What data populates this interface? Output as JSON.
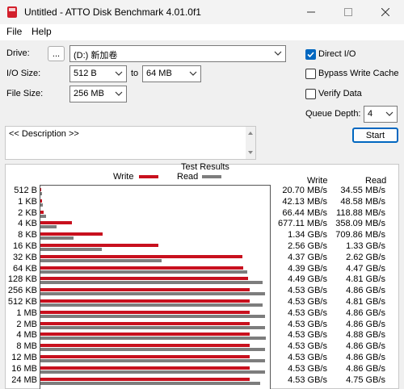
{
  "window": {
    "title": "Untitled - ATTO Disk Benchmark 4.01.0f1"
  },
  "menu": [
    "File",
    "Help"
  ],
  "settings": {
    "drive_label": "Drive:",
    "browse_label": "...",
    "drive_value": "(D:) 新加卷",
    "io_size_label": "I/O Size:",
    "io_from": "512 B",
    "to_label": "to",
    "io_to": "64 MB",
    "file_size_label": "File Size:",
    "file_size": "256 MB",
    "direct_io": "Direct I/O",
    "bypass_write_cache": "Bypass Write Cache",
    "verify_data": "Verify Data",
    "queue_depth_label": "Queue Depth:",
    "queue_depth": "4",
    "start_label": "Start"
  },
  "checks": {
    "direct_io": true,
    "bypass_write_cache": false,
    "verify_data": false
  },
  "description_text": "<< Description >>",
  "results": {
    "title": "Test Results",
    "legend_write": "Write",
    "legend_read": "Read",
    "col_write": "Write",
    "col_read": "Read",
    "colors": {
      "write": "#c8101e",
      "read": "#7d7d7d"
    }
  },
  "chart_data": {
    "type": "bar",
    "title": "Test Results",
    "categories": [
      "512 B",
      "1 KB",
      "2 KB",
      "4 KB",
      "8 KB",
      "16 KB",
      "32 KB",
      "64 KB",
      "128 KB",
      "256 KB",
      "512 KB",
      "1 MB",
      "2 MB",
      "4 MB",
      "8 MB",
      "12 MB",
      "16 MB",
      "24 MB"
    ],
    "series": [
      {
        "name": "Write",
        "values": [
          0.0207,
          0.0421,
          0.0664,
          0.677,
          1.34,
          2.56,
          4.37,
          4.39,
          4.49,
          4.53,
          4.53,
          4.53,
          4.53,
          4.53,
          4.53,
          4.53,
          4.53,
          4.53
        ],
        "labels": [
          "20.70 MB/s",
          "42.13 MB/s",
          "66.44 MB/s",
          "677.11 MB/s",
          "1.34 GB/s",
          "2.56 GB/s",
          "4.37 GB/s",
          "4.39 GB/s",
          "4.49 GB/s",
          "4.53 GB/s",
          "4.53 GB/s",
          "4.53 GB/s",
          "4.53 GB/s",
          "4.53 GB/s",
          "4.53 GB/s",
          "4.53 GB/s",
          "4.53 GB/s",
          "4.53 GB/s"
        ]
      },
      {
        "name": "Read",
        "values": [
          0.0346,
          0.0486,
          0.1189,
          0.358,
          0.71,
          1.33,
          2.62,
          4.47,
          4.81,
          4.86,
          4.81,
          4.86,
          4.86,
          4.88,
          4.86,
          4.86,
          4.86,
          4.75
        ],
        "labels": [
          "34.55 MB/s",
          "48.58 MB/s",
          "118.88 MB/s",
          "358.09 MB/s",
          "709.86 MB/s",
          "1.33 GB/s",
          "2.62 GB/s",
          "4.47 GB/s",
          "4.81 GB/s",
          "4.86 GB/s",
          "4.81 GB/s",
          "4.86 GB/s",
          "4.86 GB/s",
          "4.88 GB/s",
          "4.86 GB/s",
          "4.86 GB/s",
          "4.86 GB/s",
          "4.75 GB/s"
        ]
      }
    ],
    "unit": "GB/s",
    "xlim": [
      0,
      5
    ]
  }
}
